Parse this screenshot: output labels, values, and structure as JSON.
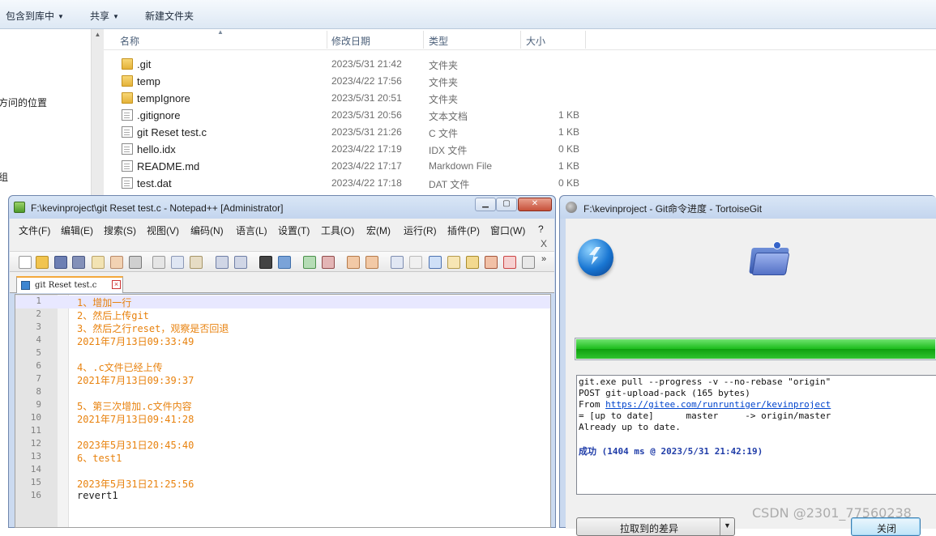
{
  "explorer": {
    "toolbar": {
      "include_label": "包含到库中",
      "share_label": "共享",
      "new_folder_label": "新建文件夹"
    },
    "nav": {
      "item_recent": "方问的位置",
      "item_group": "组"
    },
    "columns": {
      "name": "名称",
      "modified": "修改日期",
      "type": "类型",
      "size": "大小"
    },
    "files": [
      {
        "name": ".git",
        "date": "2023/5/31 21:42",
        "type": "文件夹",
        "size": "",
        "icon": "folder-icon"
      },
      {
        "name": "temp",
        "date": "2023/4/22 17:56",
        "type": "文件夹",
        "size": "",
        "icon": "folder-icon"
      },
      {
        "name": "tempIgnore",
        "date": "2023/5/31 20:51",
        "type": "文件夹",
        "size": "",
        "icon": "folder-icon"
      },
      {
        "name": ".gitignore",
        "date": "2023/5/31 20:56",
        "type": "文本文档",
        "size": "1 KB",
        "icon": "text-file-icon"
      },
      {
        "name": "git Reset test.c",
        "date": "2023/5/31 21:26",
        "type": "C 文件",
        "size": "1 KB",
        "icon": "c-file-icon"
      },
      {
        "name": "hello.idx",
        "date": "2023/4/22 17:19",
        "type": "IDX 文件",
        "size": "0 KB",
        "icon": "file-icon"
      },
      {
        "name": "README.md",
        "date": "2023/4/22 17:17",
        "type": "Markdown File",
        "size": "1 KB",
        "icon": "markdown-file-icon"
      },
      {
        "name": "test.dat",
        "date": "2023/4/22 17:18",
        "type": "DAT 文件",
        "size": "0 KB",
        "icon": "file-icon"
      }
    ]
  },
  "notepad": {
    "title": "F:\\kevinproject\\git Reset test.c - Notepad++ [Administrator]",
    "menu": [
      "文件(F)",
      "编辑(E)",
      "搜索(S)",
      "视图(V)",
      "编码(N)",
      "语言(L)",
      "设置(T)",
      "工具(O)",
      "宏(M)",
      "运行(R)",
      "插件(P)",
      "窗口(W)",
      "?"
    ],
    "menu_close": "X",
    "tab_label": "git Reset test.c",
    "lines": [
      {
        "num": "1",
        "text": "1、增加一行"
      },
      {
        "num": "2",
        "text": "2、然后上传git"
      },
      {
        "num": "3",
        "text": "3、然后之行reset，观察是否回退"
      },
      {
        "num": "4",
        "text": "2021年7月13日09:33:49"
      },
      {
        "num": "5",
        "text": ""
      },
      {
        "num": "6",
        "text": "4、.c文件已经上传"
      },
      {
        "num": "7",
        "text": "2021年7月13日09:39:37"
      },
      {
        "num": "8",
        "text": ""
      },
      {
        "num": "9",
        "text": "5、第三次增加.c文件内容"
      },
      {
        "num": "10",
        "text": "2021年7月13日09:41:28"
      },
      {
        "num": "11",
        "text": ""
      },
      {
        "num": "12",
        "text": "2023年5月31日20:45:40"
      },
      {
        "num": "13",
        "text": "6、test1"
      },
      {
        "num": "14",
        "text": ""
      },
      {
        "num": "15",
        "text": "2023年5月31日21:25:56"
      },
      {
        "num": "16",
        "text": "revert1"
      }
    ]
  },
  "tortoise": {
    "title": "F:\\kevinproject - Git命令进度 - TortoiseGit",
    "progress": 1.0,
    "log": {
      "line1": "git.exe pull --progress -v --no-rebase \"origin\"",
      "line2": "POST git-upload-pack (165 bytes)",
      "line3_prefix": "From ",
      "line3_url": "https://gitee.com/runruntiger/kevinproject",
      "line4": "= [up to date]      master     -> origin/master",
      "line5": "Already up to date.",
      "success": "成功 (1404 ms @ 2023/5/31 21:42:19)"
    },
    "diff_button": "拉取到的差异",
    "close_button": "关闭"
  },
  "watermark": "CSDN @2301_77560238",
  "colors": {
    "progress_green": "#1cbc1c",
    "code_orange": "#e8820e",
    "link_blue": "#0044cc"
  }
}
